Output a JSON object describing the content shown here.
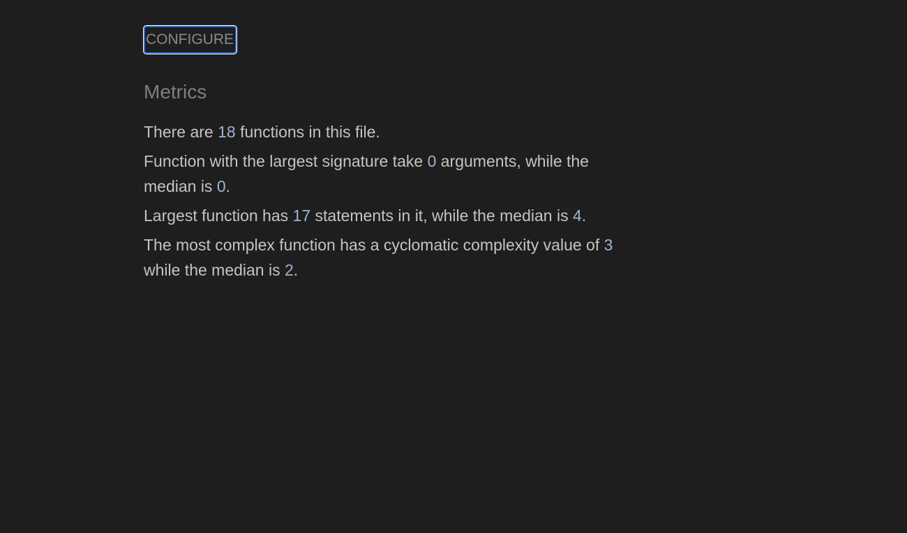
{
  "configure": {
    "label": "CONFIGURE"
  },
  "metrics": {
    "heading": "Metrics",
    "functions": {
      "before": "There are ",
      "count": "18",
      "after": " functions in this file."
    },
    "signature": {
      "before": "Function with the largest signature take ",
      "largest": "0",
      "middle": " arguments, while the median is ",
      "median": "0",
      "after": "."
    },
    "statements": {
      "before": "Largest function has ",
      "largest": "17",
      "middle": " statements in it, while the median is ",
      "median": "4",
      "after": "."
    },
    "complexity": {
      "before": "The most complex function has a cyclomatic complexity value of ",
      "largest": "3",
      "middle": " while the median is ",
      "median": "2",
      "after": "."
    }
  }
}
